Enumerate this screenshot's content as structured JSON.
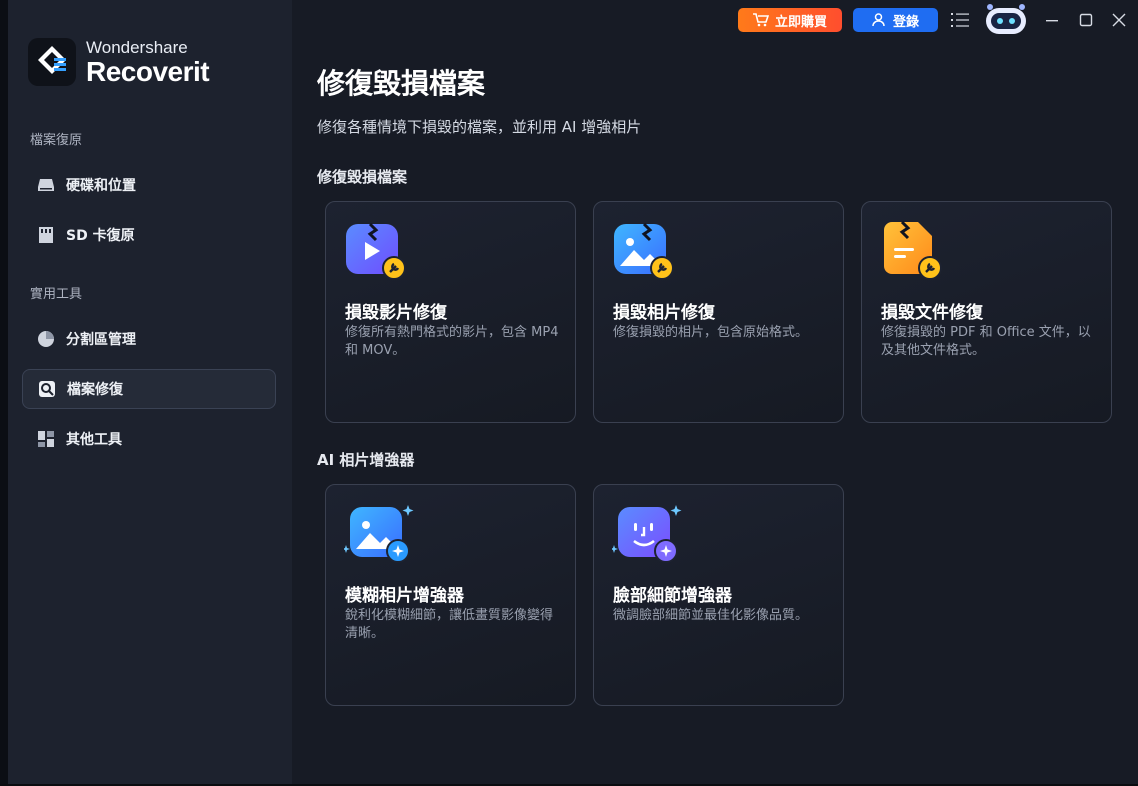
{
  "brand": {
    "top": "Wondershare",
    "bottom": "Recoverit"
  },
  "topbar": {
    "buy_label": "立即購買",
    "login_label": "登錄"
  },
  "sidebar": {
    "section1": "檔案復原",
    "items1": [
      {
        "label": "硬碟和位置",
        "icon": "drive-icon"
      },
      {
        "label": "SD 卡復原",
        "icon": "sd-card-icon"
      }
    ],
    "section2": "實用工具",
    "items2": [
      {
        "label": "分割區管理",
        "icon": "pie-chart-icon"
      },
      {
        "label": "檔案修復",
        "icon": "file-repair-icon"
      },
      {
        "label": "其他工具",
        "icon": "grid-icon"
      }
    ],
    "active": "檔案修復"
  },
  "main": {
    "title": "修復毀損檔案",
    "subtitle": "修復各種情境下損毀的檔案，並利用 AI 增強相片",
    "group1": "修復毀損檔案",
    "cards1": [
      {
        "title": "損毀影片修復",
        "desc": "修復所有熱門格式的影片，包含 MP4 和 MOV。",
        "icon": "video-repair-icon"
      },
      {
        "title": "損毀相片修復",
        "desc": "修復損毀的相片，包含原始格式。",
        "icon": "photo-repair-icon"
      },
      {
        "title": "損毀文件修復",
        "desc": "修復損毀的 PDF 和 Office 文件，以及其他文件格式。",
        "icon": "document-repair-icon"
      }
    ],
    "group2": "AI 相片增強器",
    "cards2": [
      {
        "title": "模糊相片增強器",
        "desc": "銳利化模糊細節，讓低畫質影像變得清晰。",
        "icon": "photo-enhance-icon"
      },
      {
        "title": "臉部細節增強器",
        "desc": "微調臉部細節並最佳化影像品質。",
        "icon": "face-enhance-icon"
      }
    ]
  },
  "colors": {
    "accent": "#1f6df2",
    "buy": "#ff5a24",
    "sidebar": "#1d222e",
    "main": "#171b25"
  }
}
